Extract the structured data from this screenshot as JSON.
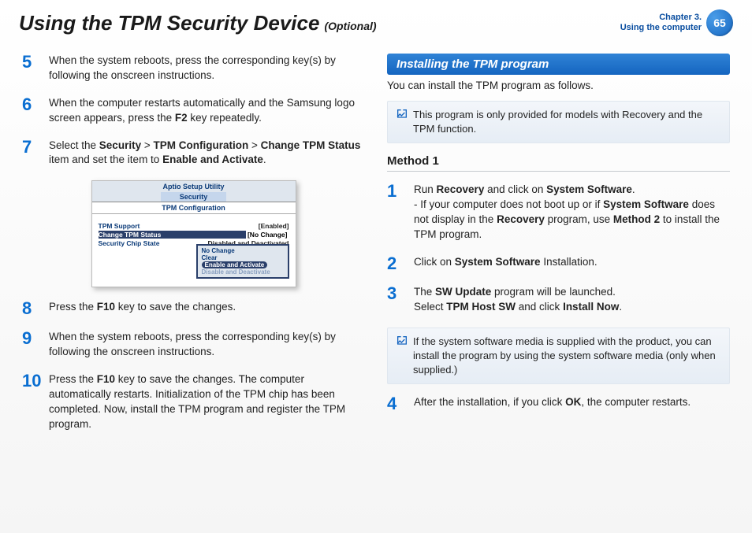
{
  "header": {
    "title": "Using the TPM Security Device",
    "optional": "(Optional)",
    "chapter_line1": "Chapter 3.",
    "chapter_line2": "Using the computer",
    "page": "65"
  },
  "left": {
    "step5": "When the system reboots, press the corresponding key(s) by following the onscreen instructions.",
    "step6_a": "When the computer restarts automatically and the Samsung logo screen appears, press the ",
    "step6_b": "F2",
    "step6_c": " key repeatedly.",
    "step7_a": "Select the ",
    "step7_b": "Security",
    "step7_c": " > ",
    "step7_d": "TPM Configuration",
    "step7_e": " > ",
    "step7_f": "Change TPM Status",
    "step7_g": " item and set the item to ",
    "step7_h": "Enable and Activate",
    "step7_i": ".",
    "step8_a": "Press the ",
    "step8_b": "F10",
    "step8_c": " key to save the changes.",
    "step9": "When the system reboots, press the corresponding key(s) by following the onscreen instructions.",
    "step10_a": "Press the ",
    "step10_b": "F10",
    "step10_c": " key to save the changes. The computer automatically restarts. Initialization of the TPM chip has been completed. Now, install the TPM program and register the TPM program."
  },
  "bios": {
    "util": "Aptio Setup Utility",
    "tab": "Security",
    "sub": "TPM Configuration",
    "r1l": "TPM Support",
    "r1r": "[Enabled]",
    "r2l": "Change TPM Status",
    "r2r": "[No Change]",
    "r3l": "Security Chip State",
    "r3r": "Disabled and Deactivated",
    "p1": "No Change",
    "p2": "Clear",
    "p3": "Enable and Activate",
    "p4": "Disable and Deactivate"
  },
  "right": {
    "section": "Installing the TPM program",
    "intro": "You can install the TPM program as follows.",
    "note1": "This program is only provided for models with Recovery  and the TPM function.",
    "method1": "Method 1",
    "s1_a": "Run ",
    "s1_b": "Recovery",
    "s1_c": " and click on ",
    "s1_d": "System Software",
    "s1_e": ".",
    "s1_f": "- If your computer does not boot up or if ",
    "s1_g": "System Software",
    "s1_h": " does not display in the ",
    "s1_i": "Recovery",
    "s1_j": " program, use ",
    "s1_k": "Method 2",
    "s1_l": " to install the TPM program.",
    "s2_a": "Click on ",
    "s2_b": "System Software",
    "s2_c": " Installation.",
    "s3_a": "The ",
    "s3_b": "SW Update",
    "s3_c": " program will be launched.",
    "s3_d": "Select ",
    "s3_e": "TPM Host SW",
    "s3_f": " and click ",
    "s3_g": "Install Now",
    "s3_h": ".",
    "note2": "If the system software media is supplied with the product, you can install the program by using the system software media (only when supplied.)",
    "s4_a": "After the installation, if you click ",
    "s4_b": "OK",
    "s4_c": ", the computer restarts."
  }
}
